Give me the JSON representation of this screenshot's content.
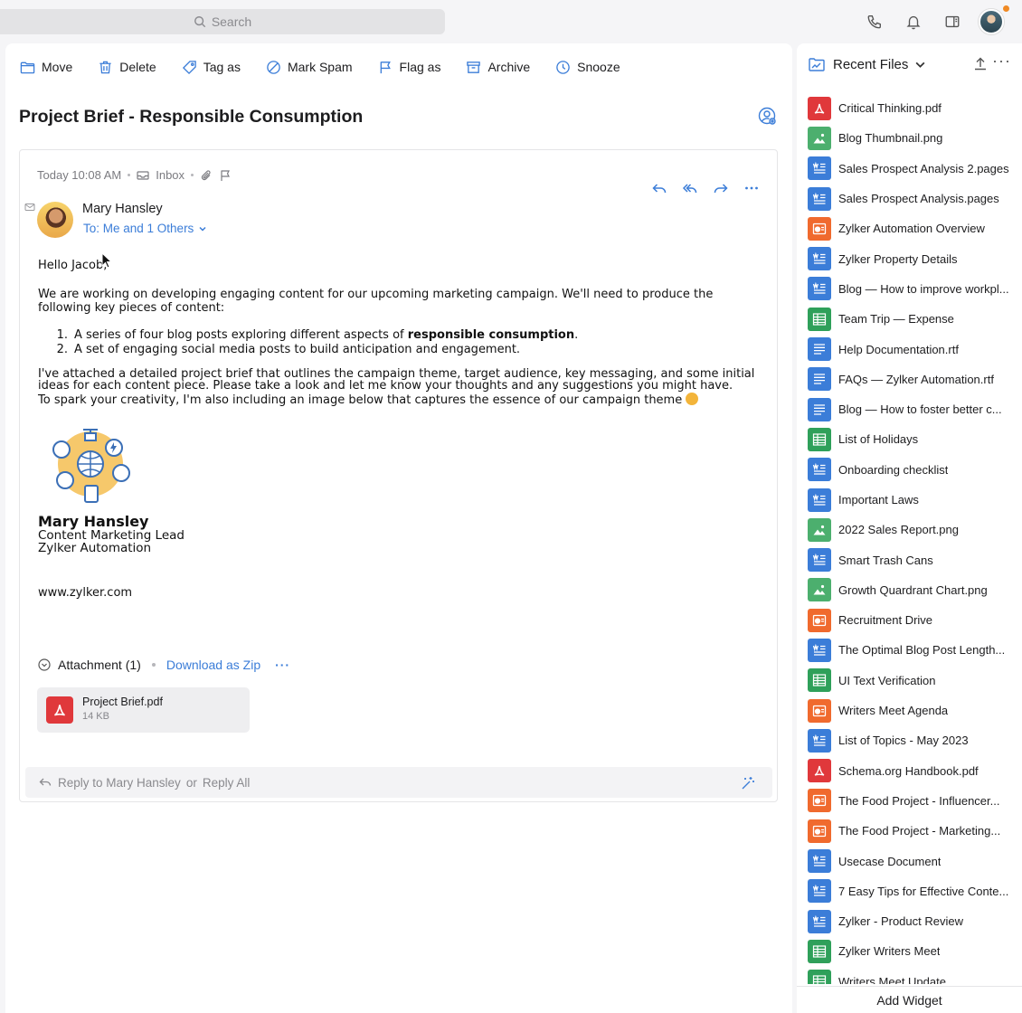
{
  "search": {
    "placeholder": "Search"
  },
  "toolbar": {
    "items": [
      {
        "label": "Move",
        "icon": "folder-icon"
      },
      {
        "label": "Delete",
        "icon": "trash-icon"
      },
      {
        "label": "Tag as",
        "icon": "tag-icon"
      },
      {
        "label": "Mark Spam",
        "icon": "spam-icon"
      },
      {
        "label": "Flag as",
        "icon": "flag-icon"
      },
      {
        "label": "Archive",
        "icon": "archive-icon"
      },
      {
        "label": "Snooze",
        "icon": "clock-icon"
      }
    ]
  },
  "email": {
    "subject": "Project Brief - Responsible Consumption",
    "date": "Today 10:08 AM",
    "folder": "Inbox",
    "sender": "Mary Hansley",
    "to": "To: Me and 1 Others",
    "greeting": "Hello Jacob,",
    "para1": "We are working on developing engaging content for our upcoming marketing campaign. We'll need to produce the following key pieces of content:",
    "list": [
      {
        "num": "1.",
        "pre": "A series of four blog posts exploring different aspects of ",
        "bold": "responsible consumption",
        "post": "."
      },
      {
        "num": "2.",
        "pre": "A set of engaging social media posts to build anticipation and engagement.",
        "bold": "",
        "post": ""
      }
    ],
    "para2": "I've attached a detailed project brief that outlines the campaign theme, target audience, key messaging, and some initial ideas for each content piece. Please take a look and let me know your thoughts and any suggestions you might have.",
    "para3": "To spark your creativity, I'm also including an image below that captures the essence of our campaign theme",
    "signature": {
      "name": "Mary Hansley",
      "role": "Content Marketing Lead",
      "company": "Zylker Automation",
      "website": "www.zylker.com"
    },
    "attachments": {
      "title": "Attachment (1)",
      "download": "Download as Zip",
      "more": "···",
      "files": [
        {
          "name": "Project Brief.pdf",
          "size": "14 KB"
        }
      ]
    },
    "reply": {
      "reply_to": "Reply to Mary Hansley",
      "or": "or",
      "reply_all": "Reply All"
    }
  },
  "recent_files": {
    "title": "Recent Files",
    "footer": "Add Widget",
    "colors": {
      "pdf": "#e0383b",
      "image": "#4caf6e",
      "doc": "#3b7dd8",
      "ppt": "#f06a2e",
      "sheet": "#2fa05a",
      "rtf": "#3b7dd8"
    },
    "items": [
      {
        "name": "Critical Thinking.pdf",
        "type": "pdf"
      },
      {
        "name": "Blog Thumbnail.png",
        "type": "image"
      },
      {
        "name": "Sales Prospect Analysis 2.pages",
        "type": "doc"
      },
      {
        "name": "Sales Prospect Analysis.pages",
        "type": "doc"
      },
      {
        "name": "Zylker Automation Overview",
        "type": "ppt"
      },
      {
        "name": "Zylker Property Details",
        "type": "doc"
      },
      {
        "name": "Blog — How to improve workpl...",
        "type": "doc"
      },
      {
        "name": "Team Trip — Expense",
        "type": "sheet"
      },
      {
        "name": "Help Documentation.rtf",
        "type": "rtf"
      },
      {
        "name": "FAQs — Zylker Automation.rtf",
        "type": "rtf"
      },
      {
        "name": "Blog — How to foster better c...",
        "type": "rtf"
      },
      {
        "name": "List of Holidays",
        "type": "sheet"
      },
      {
        "name": "Onboarding checklist",
        "type": "doc"
      },
      {
        "name": "Important Laws",
        "type": "doc"
      },
      {
        "name": "2022 Sales Report.png",
        "type": "image"
      },
      {
        "name": "Smart Trash Cans",
        "type": "doc"
      },
      {
        "name": "Growth Quardrant Chart.png",
        "type": "image"
      },
      {
        "name": "Recruitment Drive",
        "type": "ppt"
      },
      {
        "name": "The Optimal Blog Post Length...",
        "type": "doc"
      },
      {
        "name": "UI Text Verification",
        "type": "sheet"
      },
      {
        "name": "Writers Meet Agenda",
        "type": "ppt"
      },
      {
        "name": "List of Topics - May 2023",
        "type": "doc"
      },
      {
        "name": "Schema.org Handbook.pdf",
        "type": "pdf"
      },
      {
        "name": "The Food Project - Influencer...",
        "type": "ppt"
      },
      {
        "name": "The Food Project - Marketing...",
        "type": "ppt"
      },
      {
        "name": "Usecase Document",
        "type": "doc"
      },
      {
        "name": "7 Easy Tips for Effective Conte...",
        "type": "doc"
      },
      {
        "name": "Zylker - Product Review",
        "type": "doc"
      },
      {
        "name": "Zylker Writers Meet",
        "type": "sheet"
      },
      {
        "name": "Writers Meet Update",
        "type": "sheet"
      }
    ]
  }
}
